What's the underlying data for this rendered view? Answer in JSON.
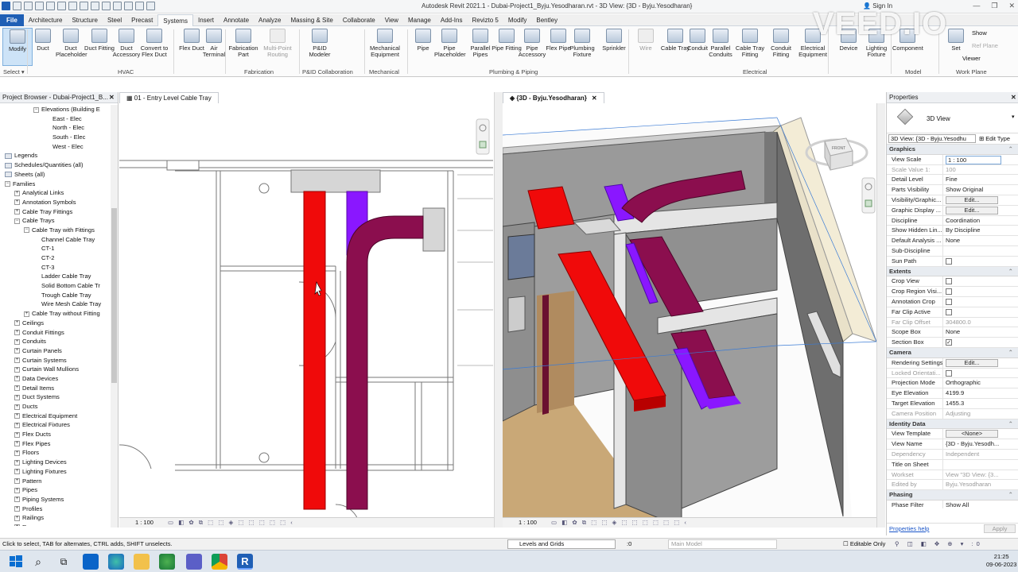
{
  "titlebar": {
    "title": "Autodesk Revit 2021.1 - Dubai-Project1_Byju.Yesodharan.rvt - 3D View: {3D - Byju.Yesodharan}",
    "sign_in": "Sign In",
    "watermark": "VEED.IO"
  },
  "tabs": [
    "File",
    "Architecture",
    "Structure",
    "Steel",
    "Precast",
    "Systems",
    "Insert",
    "Annotate",
    "Analyze",
    "Massing & Site",
    "Collaborate",
    "View",
    "Manage",
    "Add-Ins",
    "Revizto 5",
    "Modify",
    "Bentley"
  ],
  "active_tab": "Systems",
  "ribbon": {
    "buttons": [
      {
        "label": "Modify",
        "icon": "cursor-icon"
      },
      {
        "label": "Duct",
        "icon": "duct-icon"
      },
      {
        "label": "Duct Placeholder",
        "icon": "duct-placeholder-icon"
      },
      {
        "label": "Duct Fitting",
        "icon": "duct-fitting-icon"
      },
      {
        "label": "Duct Accessory",
        "icon": "duct-accessory-icon"
      },
      {
        "label": "Convert to Flex Duct",
        "icon": "convert-flex-duct-icon"
      },
      {
        "label": "Flex Duct",
        "icon": "flex-duct-icon"
      },
      {
        "label": "Air Terminal",
        "icon": "air-terminal-icon"
      },
      {
        "label": "Fabrication Part",
        "icon": "fabrication-part-icon"
      },
      {
        "label": "Multi-Point Routing",
        "icon": "multi-point-routing-icon"
      },
      {
        "label": "P&ID Modeler",
        "icon": "pid-modeler-icon"
      },
      {
        "label": "Mechanical Equipment",
        "icon": "mechanical-equipment-icon"
      },
      {
        "label": "Pipe",
        "icon": "pipe-icon"
      },
      {
        "label": "Pipe Placeholder",
        "icon": "pipe-placeholder-icon"
      },
      {
        "label": "Parallel Pipes",
        "icon": "parallel-pipes-icon"
      },
      {
        "label": "Pipe Fitting",
        "icon": "pipe-fitting-icon"
      },
      {
        "label": "Pipe Accessory",
        "icon": "pipe-accessory-icon"
      },
      {
        "label": "Flex Pipe",
        "icon": "flex-pipe-icon"
      },
      {
        "label": "Plumbing Fixture",
        "icon": "plumbing-fixture-icon"
      },
      {
        "label": "Sprinkler",
        "icon": "sprinkler-icon"
      },
      {
        "label": "Wire",
        "icon": "wire-icon"
      },
      {
        "label": "Cable Tray",
        "icon": "cable-tray-icon"
      },
      {
        "label": "Conduit",
        "icon": "conduit-icon"
      },
      {
        "label": "Parallel Conduits",
        "icon": "parallel-conduits-icon"
      },
      {
        "label": "Cable Tray Fitting",
        "icon": "cable-tray-fitting-icon"
      },
      {
        "label": "Conduit Fitting",
        "icon": "conduit-fitting-icon"
      },
      {
        "label": "Electrical Equipment",
        "icon": "electrical-equipment-icon"
      },
      {
        "label": "Device",
        "icon": "device-icon"
      },
      {
        "label": "Lighting Fixture",
        "icon": "lighting-fixture-icon"
      },
      {
        "label": "Component",
        "icon": "component-icon"
      },
      {
        "label": "Set",
        "icon": "set-icon"
      }
    ],
    "workplane": {
      "show": "Show",
      "ref_plane": "Ref Plane",
      "viewer": "Viewer"
    },
    "groups": [
      "Select ▾",
      "HVAC",
      "Fabrication",
      "P&ID Collaboration",
      "Mechanical",
      "Plumbing & Piping",
      "Electrical",
      "Model",
      "Work Plane"
    ]
  },
  "project_browser": {
    "title": "Project Browser - Dubai-Project1_B...",
    "items": [
      {
        "label": "Elevations (Building E",
        "expanded": "−"
      },
      {
        "label": "East - Elec",
        "expanded": ""
      },
      {
        "label": "North - Elec",
        "expanded": ""
      },
      {
        "label": "South - Elec",
        "expanded": ""
      },
      {
        "label": "West - Elec",
        "expanded": ""
      },
      {
        "label": "Legends",
        "expanded": ""
      },
      {
        "label": "Schedules/Quantities (all)",
        "expanded": ""
      },
      {
        "label": "Sheets (all)",
        "expanded": ""
      },
      {
        "label": "Families",
        "expanded": "−"
      },
      {
        "label": "Analytical Links",
        "expanded": "+"
      },
      {
        "label": "Annotation Symbols",
        "expanded": "+"
      },
      {
        "label": "Cable Tray Fittings",
        "expanded": "+"
      },
      {
        "label": "Cable Trays",
        "expanded": "−"
      },
      {
        "label": "Cable Tray with Fittings",
        "expanded": "−"
      },
      {
        "label": "Channel Cable Tray",
        "expanded": ""
      },
      {
        "label": "CT-1",
        "expanded": ""
      },
      {
        "label": "CT-2",
        "expanded": ""
      },
      {
        "label": "CT-3",
        "expanded": ""
      },
      {
        "label": "Ladder Cable Tray",
        "expanded": ""
      },
      {
        "label": "Solid Bottom Cable Tr",
        "expanded": ""
      },
      {
        "label": "Trough Cable Tray",
        "expanded": ""
      },
      {
        "label": "Wire Mesh Cable Tray",
        "expanded": ""
      },
      {
        "label": "Cable Tray without Fitting",
        "expanded": "+"
      },
      {
        "label": "Ceilings",
        "expanded": "+"
      },
      {
        "label": "Conduit Fittings",
        "expanded": "+"
      },
      {
        "label": "Conduits",
        "expanded": "+"
      },
      {
        "label": "Curtain Panels",
        "expanded": "+"
      },
      {
        "label": "Curtain Systems",
        "expanded": "+"
      },
      {
        "label": "Curtain Wall Mullions",
        "expanded": "+"
      },
      {
        "label": "Data Devices",
        "expanded": "+"
      },
      {
        "label": "Detail Items",
        "expanded": "+"
      },
      {
        "label": "Duct Systems",
        "expanded": "+"
      },
      {
        "label": "Ducts",
        "expanded": "+"
      },
      {
        "label": "Electrical Equipment",
        "expanded": "+"
      },
      {
        "label": "Electrical Fixtures",
        "expanded": "+"
      },
      {
        "label": "Flex Ducts",
        "expanded": "+"
      },
      {
        "label": "Flex Pipes",
        "expanded": "+"
      },
      {
        "label": "Floors",
        "expanded": "+"
      },
      {
        "label": "Lighting Devices",
        "expanded": "+"
      },
      {
        "label": "Lighting Fixtures",
        "expanded": "+"
      },
      {
        "label": "Pattern",
        "expanded": "+"
      },
      {
        "label": "Pipes",
        "expanded": "+"
      },
      {
        "label": "Piping Systems",
        "expanded": "+"
      },
      {
        "label": "Profiles",
        "expanded": "+"
      },
      {
        "label": "Railings",
        "expanded": "+"
      },
      {
        "label": "Ramps",
        "expanded": "+"
      }
    ]
  },
  "views": {
    "plan_tab": "01 - Entry Level Cable Tray",
    "plan_scale": "1 : 100",
    "v3d_tab": "{3D - Byju.Yesodharan}",
    "v3d_scale": "1 : 100",
    "cube_label": "FRONT"
  },
  "properties": {
    "title": "Properties",
    "type_name": "3D View",
    "selector": "3D View: {3D - Byju.Yesodhu",
    "edit_type": "Edit Type",
    "groups": [
      {
        "name": "Graphics",
        "rows": [
          {
            "k": "View Scale",
            "v": "1 : 100",
            "kind": "input"
          },
          {
            "k": "Scale Value    1:",
            "v": "100",
            "kind": "ro"
          },
          {
            "k": "Detail Level",
            "v": "Fine",
            "kind": "text"
          },
          {
            "k": "Parts Visibility",
            "v": "Show Original",
            "kind": "text"
          },
          {
            "k": "Visibility/Graphic...",
            "v": "Edit...",
            "kind": "button"
          },
          {
            "k": "Graphic Display ...",
            "v": "Edit...",
            "kind": "button"
          },
          {
            "k": "Discipline",
            "v": "Coordination",
            "kind": "text"
          },
          {
            "k": "Show Hidden Lin...",
            "v": "By Discipline",
            "kind": "text"
          },
          {
            "k": "Default Analysis ...",
            "v": "None",
            "kind": "text"
          },
          {
            "k": "Sub-Discipline",
            "v": "",
            "kind": "text"
          },
          {
            "k": "Sun Path",
            "v": "",
            "kind": "check"
          }
        ]
      },
      {
        "name": "Extents",
        "rows": [
          {
            "k": "Crop View",
            "v": "",
            "kind": "check"
          },
          {
            "k": "Crop Region Visi...",
            "v": "",
            "kind": "check"
          },
          {
            "k": "Annotation Crop",
            "v": "",
            "kind": "check"
          },
          {
            "k": "Far Clip Active",
            "v": "",
            "kind": "check"
          },
          {
            "k": "Far Clip Offset",
            "v": "304800.0",
            "kind": "ro"
          },
          {
            "k": "Scope Box",
            "v": "None",
            "kind": "text"
          },
          {
            "k": "Section Box",
            "v": "✓",
            "kind": "check"
          }
        ]
      },
      {
        "name": "Camera",
        "rows": [
          {
            "k": "Rendering Settings",
            "v": "Edit...",
            "kind": "button"
          },
          {
            "k": "Locked Orientati...",
            "v": "",
            "kind": "rocheck"
          },
          {
            "k": "Projection Mode",
            "v": "Orthographic",
            "kind": "text"
          },
          {
            "k": "Eye Elevation",
            "v": "4199.9",
            "kind": "text"
          },
          {
            "k": "Target Elevation",
            "v": "1455.3",
            "kind": "text"
          },
          {
            "k": "Camera Position",
            "v": "Adjusting",
            "kind": "ro"
          }
        ]
      },
      {
        "name": "Identity Data",
        "rows": [
          {
            "k": "View Template",
            "v": "<None>",
            "kind": "button"
          },
          {
            "k": "View Name",
            "v": "{3D - Byju.Yesodh...",
            "kind": "text"
          },
          {
            "k": "Dependency",
            "v": "Independent",
            "kind": "ro"
          },
          {
            "k": "Title on Sheet",
            "v": "",
            "kind": "text"
          },
          {
            "k": "Workset",
            "v": "View \"3D View: {3...",
            "kind": "ro"
          },
          {
            "k": "Edited by",
            "v": "Byju.Yesodharan",
            "kind": "ro"
          }
        ]
      },
      {
        "name": "Phasing",
        "rows": [
          {
            "k": "Phase Filter",
            "v": "Show All",
            "kind": "text"
          }
        ]
      }
    ],
    "help_link": "Properties help",
    "apply": "Apply"
  },
  "status": {
    "message": "Click to select, TAB for alternates, CTRL adds, SHIFT unselects.",
    "workset": "Levels and Grids",
    "coord": ":0",
    "model": "Main Model",
    "editable_only": "Editable Only",
    "filter_count": ":0"
  },
  "taskbar": {
    "time": "21:25",
    "date": "09-06-2023"
  },
  "colors": {
    "tray_red": "#f00a0a",
    "tray_maroon": "#8b0e4e",
    "tray_purple": "#8a17ff",
    "file_tab": "#1f5fb5"
  }
}
